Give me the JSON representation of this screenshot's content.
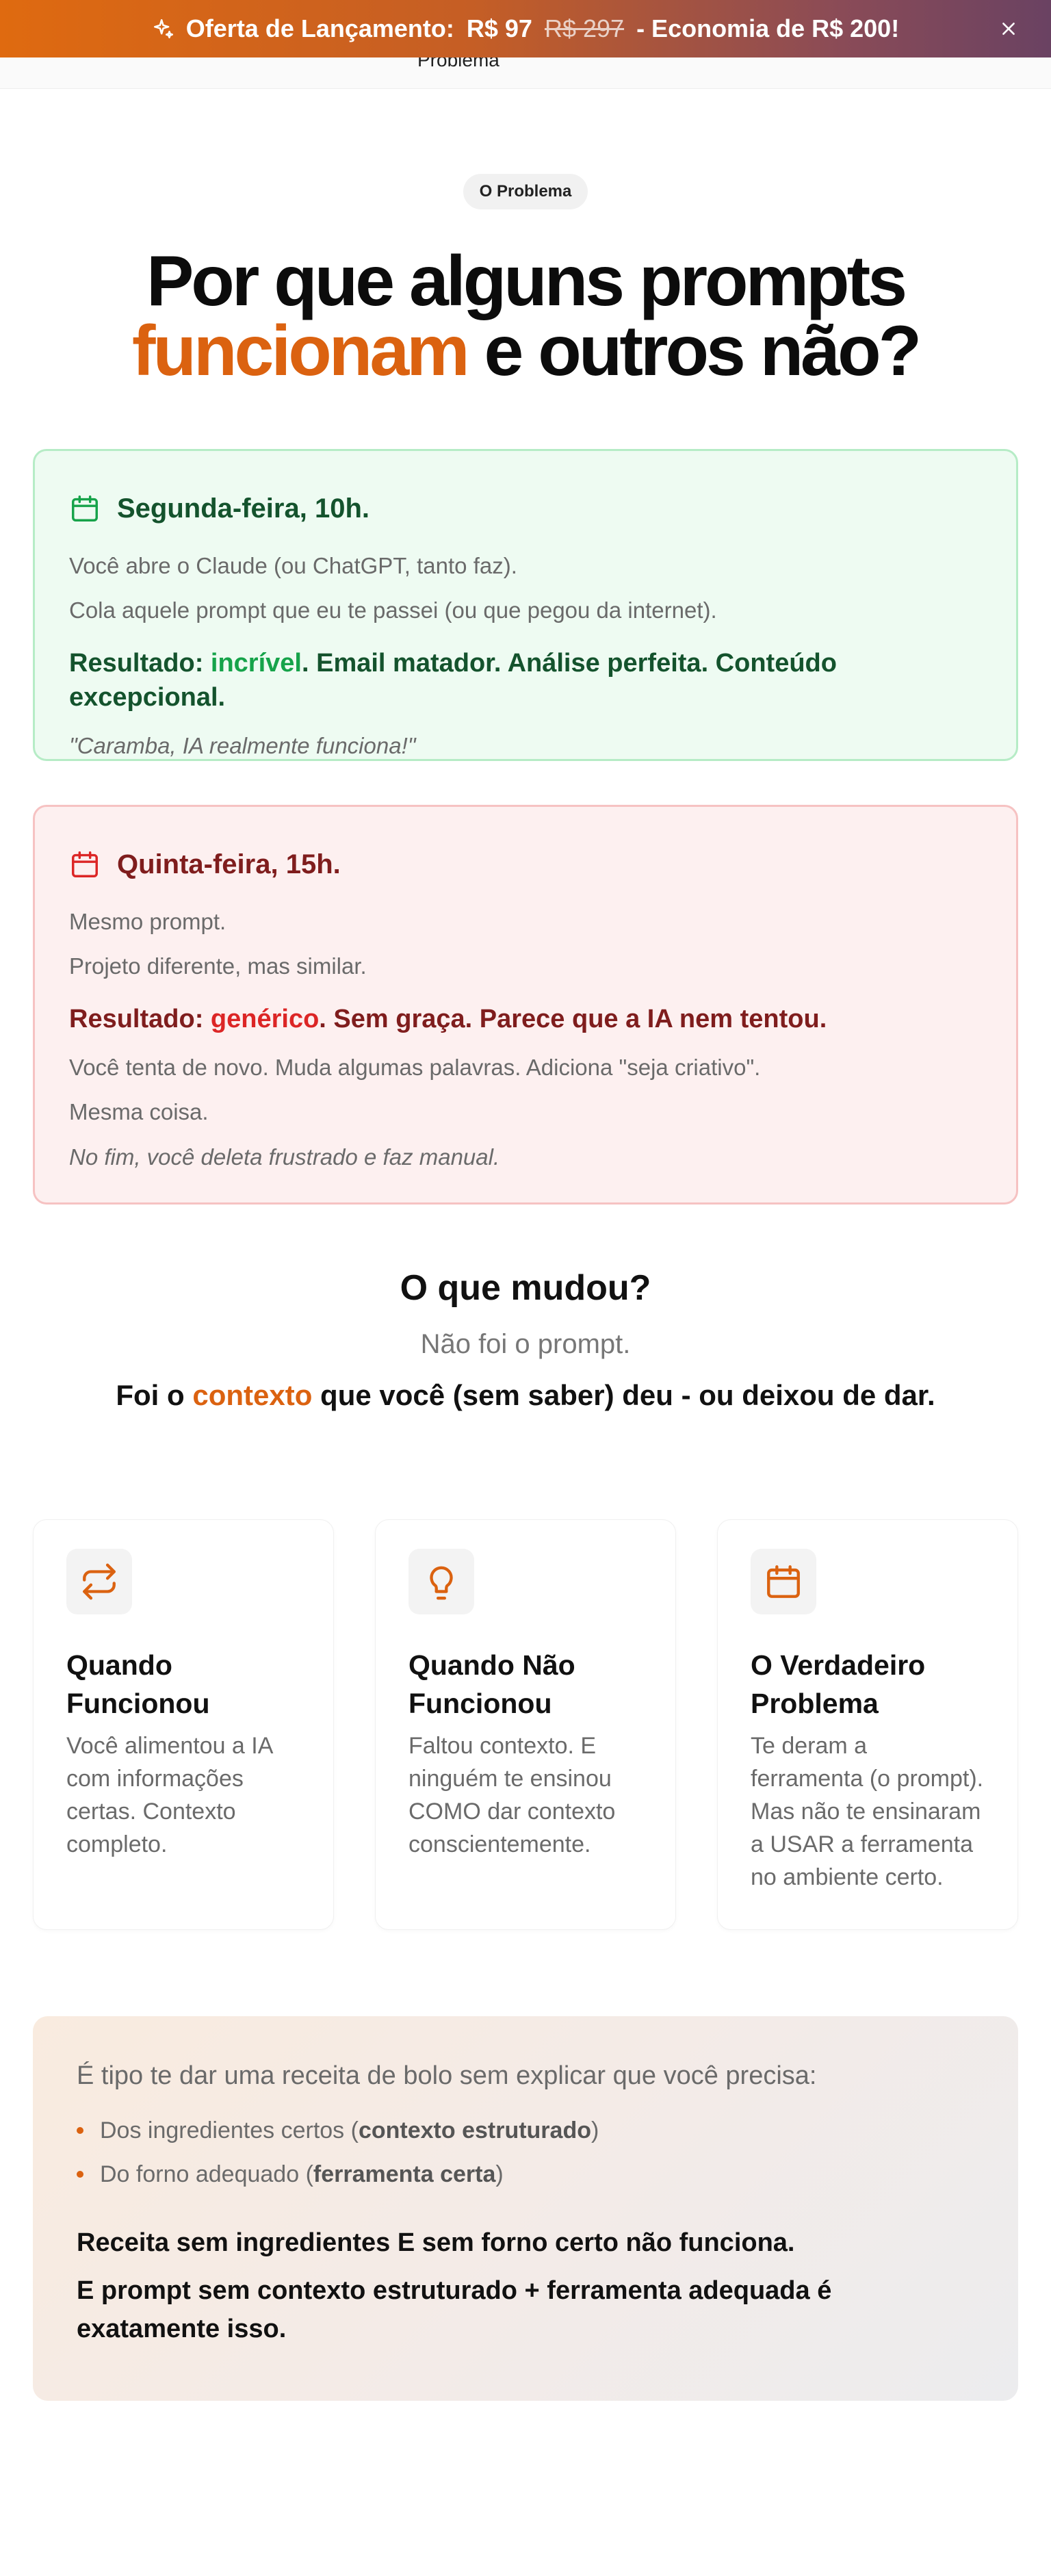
{
  "announcement": {
    "label": "Oferta de Lançamento:",
    "price": "R$ 97",
    "old_price": "R$ 297",
    "savings": "- Economia de R$ 200!",
    "sparkle_icon": "sparkle-icon",
    "close_icon": "close-icon"
  },
  "nav": {
    "link": "Problema"
  },
  "section": {
    "badge": "O Problema",
    "headline_line1": "Por que alguns prompts",
    "headline_accent": "funcionam",
    "headline_rest": " e outros não?"
  },
  "monday": {
    "title": "Segunda-feira, 10h.",
    "icon": "calendar-icon",
    "p1": "Você abre o Claude (ou ChatGPT, tanto faz).",
    "p2": "Cola aquele prompt que eu te passei (ou que pegou da internet).",
    "result_prefix": "Resultado: ",
    "result_highlight": "incrível",
    "result_rest": ". Email matador. Análise perfeita. Conteúdo excepcional.",
    "quote": "\"Caramba, IA realmente funciona!\""
  },
  "thursday": {
    "title": "Quinta-feira, 15h.",
    "icon": "calendar-icon",
    "p1": "Mesmo prompt.",
    "p2": "Projeto diferente, mas similar.",
    "result_prefix": "Resultado: ",
    "result_highlight": "genérico",
    "result_rest": ". Sem graça. Parece que a IA nem tentou.",
    "p3": "Você tenta de novo. Muda algumas palavras. Adiciona \"seja criativo\".",
    "p4": "Mesma coisa.",
    "quote": "No fim, você deleta frustrado e faz manual."
  },
  "what_changed": {
    "title": "O que mudou?",
    "subtitle": "Não foi o prompt.",
    "line_prefix": "Foi o ",
    "line_accent": "contexto",
    "line_rest": " que você (sem saber) deu - ou deixou de dar."
  },
  "features": [
    {
      "icon": "repeat-arrows-icon",
      "title": "Quando Funcionou",
      "text": "Você alimentou a IA com informações certas. Contexto completo."
    },
    {
      "icon": "lightbulb-icon",
      "title": "Quando Não Funcionou",
      "text": "Faltou contexto. E ninguém te ensinou COMO dar contexto conscientemente."
    },
    {
      "icon": "calendar-icon",
      "title": "O Verdadeiro Problema",
      "text": "Te deram a ferramenta (o prompt). Mas não te ensinaram a USAR a ferramenta no ambiente certo."
    }
  ],
  "analogy": {
    "intro": "É tipo te dar uma receita de bolo sem explicar que você precisa:",
    "items": [
      {
        "prefix": "Dos ingredientes certos (",
        "bold": "contexto estruturado",
        "suffix": ")"
      },
      {
        "prefix": "Do forno adequado (",
        "bold": "ferramenta certa",
        "suffix": ")"
      }
    ],
    "conclusion1": "Receita sem ingredientes E sem forno certo não funciona.",
    "conclusion2": "E prompt sem contexto estruturado + ferramenta adequada é exatamente isso."
  },
  "colors": {
    "accent": "#db6210",
    "green_title": "#14532d",
    "green_highlight": "#16a34a",
    "red_title": "#7f1d1d",
    "red_highlight": "#dc2626"
  }
}
